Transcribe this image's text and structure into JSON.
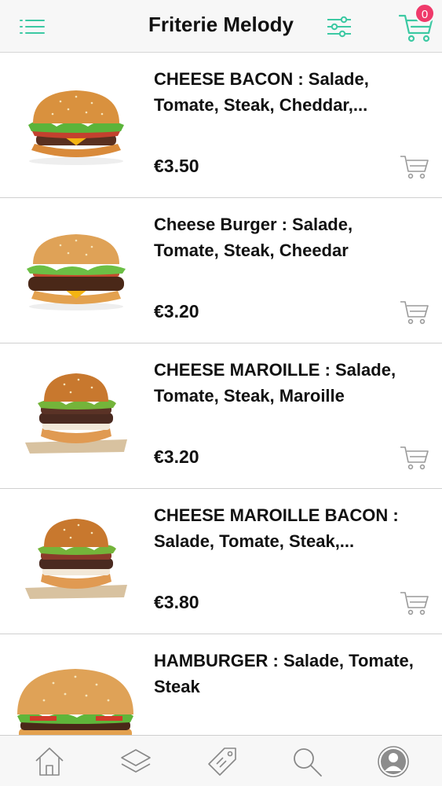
{
  "header": {
    "title": "Friterie Melody",
    "cart_count": "0",
    "icons": [
      "menu-icon",
      "filter-icon",
      "cart-icon"
    ],
    "accent_color": "#3cc9a3",
    "badge_color": "#ef3a6a"
  },
  "items": [
    {
      "name": "CHEESE BACON : Salade, Tomate, Steak, Cheddar,...",
      "price": "€3.50"
    },
    {
      "name": "Cheese Burger : Salade, Tomate, Steak, Cheedar",
      "price": "€3.20"
    },
    {
      "name": "CHEESE MAROILLE : Salade, Tomate, Steak, Maroille",
      "price": "€3.20"
    },
    {
      "name": "CHEESE MAROILLE BACON : Salade, Tomate, Steak,...",
      "price": "€3.80"
    },
    {
      "name": "HAMBURGER : Salade, Tomate, Steak",
      "price": ""
    }
  ],
  "tabbar": {
    "icons": [
      "home-icon",
      "layers-icon",
      "tag-icon",
      "search-icon",
      "profile-icon"
    ]
  }
}
